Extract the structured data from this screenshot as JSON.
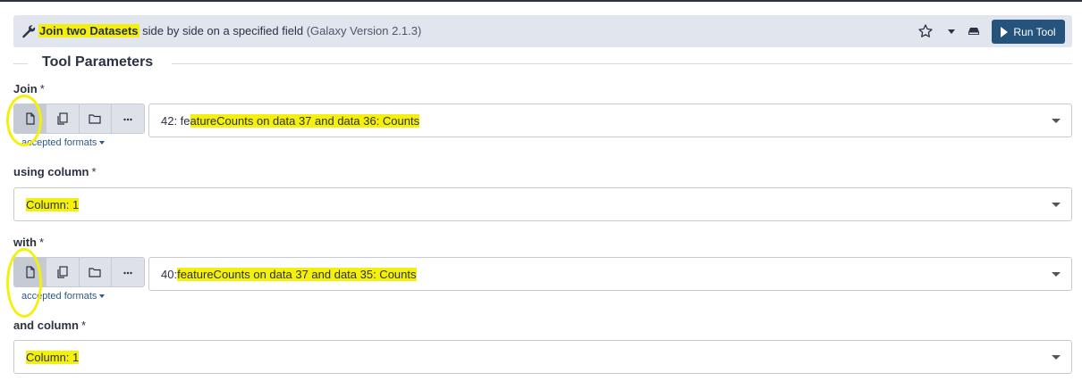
{
  "tool": {
    "name": "Join two Datasets",
    "description": " side by side on a specified field ",
    "version": "(Galaxy Version 2.1.3)",
    "run_label": "Run Tool"
  },
  "section_title": "Tool Parameters",
  "params": {
    "join": {
      "label": "Join",
      "required": "*",
      "accepted_formats": "accepted formats",
      "selected_prefix": "42: fe",
      "selected_rest": "atureCounts on data 37 and data 36: Counts"
    },
    "using_column": {
      "label": "using column",
      "required": "*",
      "selected": "Column: 1"
    },
    "with": {
      "label": "with",
      "required": "*",
      "accepted_formats": "accepted formats",
      "selected_prefix": "40: ",
      "selected_rest": "featureCounts on data 37 and data 35: Counts"
    },
    "and_column": {
      "label": "and column",
      "required": "*",
      "selected": "Column: 1"
    }
  },
  "icons": [
    "wrench-icon",
    "star-icon",
    "caret-down-icon",
    "drive-icon",
    "play-icon",
    "file-icon",
    "copy-icon",
    "folder-icon",
    "more-icon"
  ],
  "colors": {
    "accent": "#25537b",
    "highlight": "#f4f00c",
    "header_bg": "#e1e5ed"
  }
}
